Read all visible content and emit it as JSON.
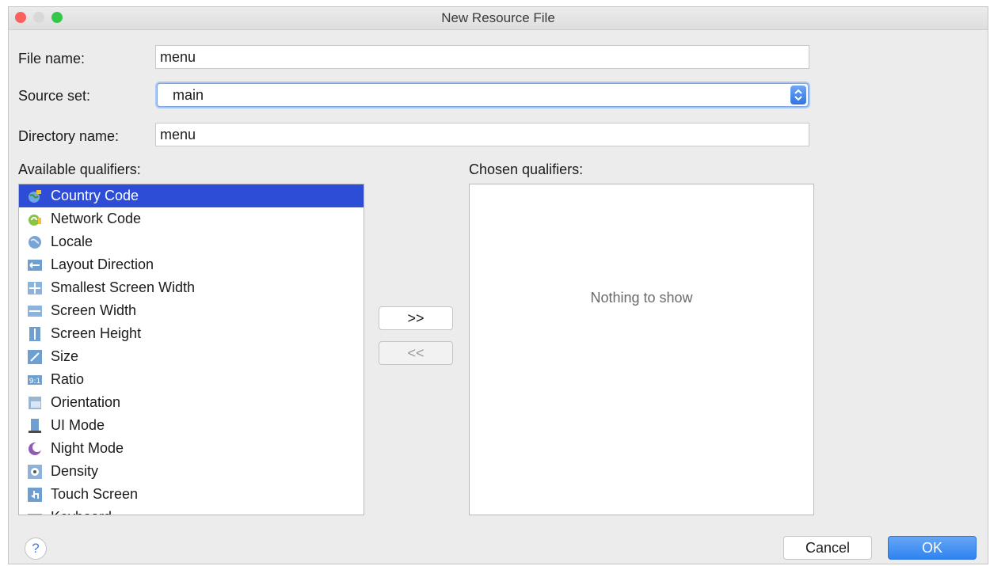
{
  "window": {
    "title": "New Resource File",
    "traffic_lights": {
      "close_color": "#fc605c",
      "minimize_color": "#d8d8d8",
      "zoom_color": "#34c84a"
    }
  },
  "form": {
    "file_name_label": "File name:",
    "file_name_value": "menu",
    "source_set_label": "Source set:",
    "source_set_value": "main",
    "directory_name_label": "Directory name:",
    "directory_name_value": "menu"
  },
  "available": {
    "label": "Available qualifiers:",
    "items": [
      {
        "label": "Country Code",
        "icon": "globe-flag-icon",
        "selected": true
      },
      {
        "label": "Network Code",
        "icon": "network-antenna-icon"
      },
      {
        "label": "Locale",
        "icon": "globe-icon"
      },
      {
        "label": "Layout Direction",
        "icon": "layout-direction-icon"
      },
      {
        "label": "Smallest Screen Width",
        "icon": "smallest-width-icon"
      },
      {
        "label": "Screen Width",
        "icon": "screen-width-icon"
      },
      {
        "label": "Screen Height",
        "icon": "screen-height-icon"
      },
      {
        "label": "Size",
        "icon": "resize-icon"
      },
      {
        "label": "Ratio",
        "icon": "ratio-icon"
      },
      {
        "label": "Orientation",
        "icon": "orientation-icon"
      },
      {
        "label": "UI Mode",
        "icon": "ui-mode-icon"
      },
      {
        "label": "Night Mode",
        "icon": "night-mode-icon"
      },
      {
        "label": "Density",
        "icon": "density-icon"
      },
      {
        "label": "Touch Screen",
        "icon": "touch-icon"
      },
      {
        "label": "Keyboard",
        "icon": "keyboard-icon"
      }
    ]
  },
  "transfer": {
    "add_label": ">>",
    "remove_label": "<<"
  },
  "chosen": {
    "label": "Chosen qualifiers:",
    "empty_text": "Nothing to show"
  },
  "footer": {
    "help_label": "?",
    "cancel_label": "Cancel",
    "ok_label": "OK"
  },
  "colors": {
    "selection": "#2d4dd6",
    "primary_button": "#2f83f0"
  }
}
